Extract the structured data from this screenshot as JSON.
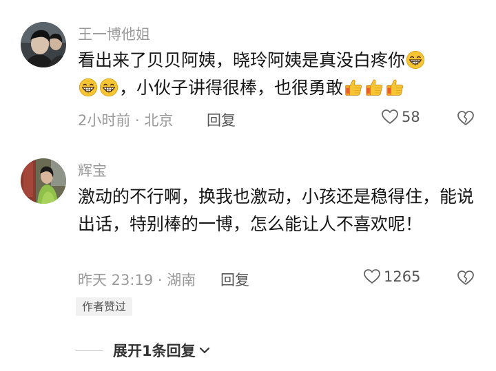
{
  "comments": [
    {
      "username": "王一博他姐",
      "text_a": "看出来了贝贝阿姨，晓玲阿姨是真没白疼你",
      "text_b": "，小伙子讲得很棒，也很勇敢",
      "time_location": "2小时前 · 北京",
      "reply_label": "回复",
      "likes": "58"
    },
    {
      "username": "辉宝",
      "text": "激动的不行啊，换我也激动，小孩还是稳得住，能说出话，特别棒的一博，怎么能让人不喜欢呢！",
      "time_location": "昨天 23:19 · 湖南",
      "reply_label": "回复",
      "likes": "1265",
      "badge": "作者赞过"
    }
  ],
  "expand_replies": "展开1条回复",
  "icons": {
    "grin": "grinning-emoji",
    "thumbs": "thumbs-up-emoji",
    "heart": "heart-outline-icon",
    "broken_heart": "broken-heart-icon",
    "chevron": "chevron-down-icon"
  },
  "colors": {
    "text": "#161616",
    "muted": "#9a9a9a",
    "badge_bg": "#f1f1f1",
    "emoji_yellow": "#f6c533"
  }
}
